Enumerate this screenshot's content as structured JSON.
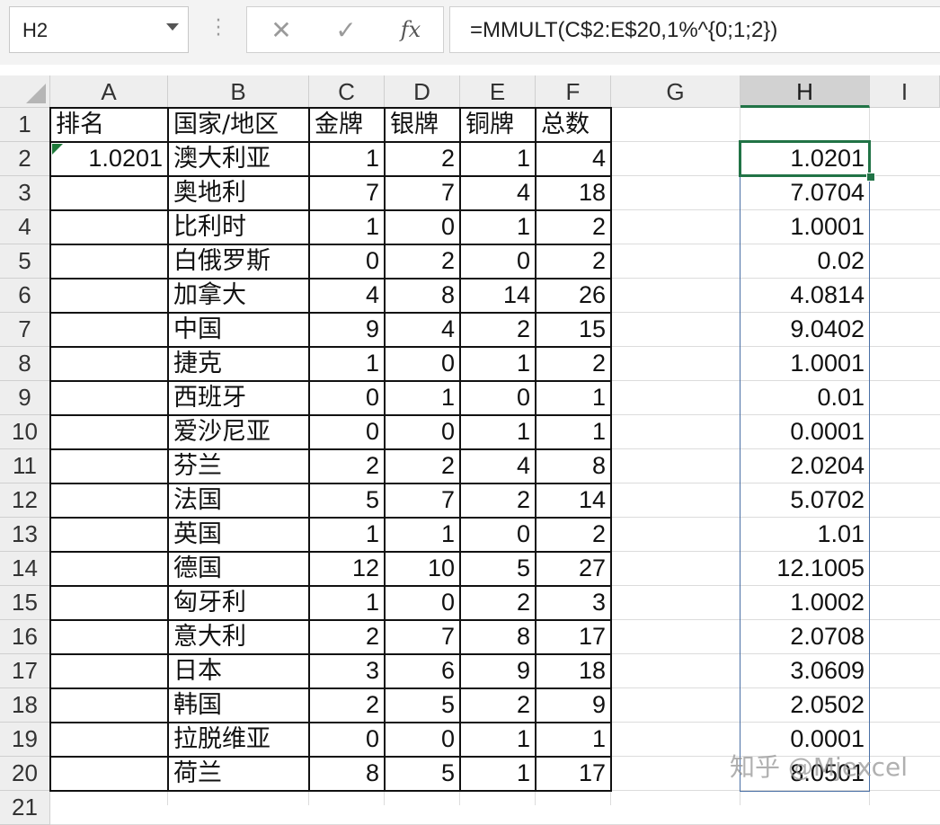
{
  "formula_bar": {
    "name_box": "H2",
    "cancel_icon": "✕",
    "enter_icon": "✓",
    "fx_label": "fx",
    "formula": "=MMULT(C$2:E$20,1%^{0;1;2})"
  },
  "columns": [
    "A",
    "B",
    "C",
    "D",
    "E",
    "F",
    "G",
    "H",
    "I"
  ],
  "selected_column": "H",
  "rows": [
    "1",
    "2",
    "3",
    "4",
    "5",
    "6",
    "7",
    "8",
    "9",
    "10",
    "11",
    "12",
    "13",
    "14",
    "15",
    "16",
    "17",
    "18",
    "19",
    "20",
    "21"
  ],
  "table": {
    "headers": [
      "排名",
      "国家/地区",
      "金牌",
      "银牌",
      "铜牌",
      "总数"
    ],
    "a2_value": "1.0201",
    "records": [
      {
        "country": "澳大利亚",
        "gold": "1",
        "silver": "2",
        "bronze": "1",
        "total": "4",
        "h": "1.0201"
      },
      {
        "country": "奥地利",
        "gold": "7",
        "silver": "7",
        "bronze": "4",
        "total": "18",
        "h": "7.0704"
      },
      {
        "country": "比利时",
        "gold": "1",
        "silver": "0",
        "bronze": "1",
        "total": "2",
        "h": "1.0001"
      },
      {
        "country": "白俄罗斯",
        "gold": "0",
        "silver": "2",
        "bronze": "0",
        "total": "2",
        "h": "0.02"
      },
      {
        "country": "加拿大",
        "gold": "4",
        "silver": "8",
        "bronze": "14",
        "total": "26",
        "h": "4.0814"
      },
      {
        "country": "中国",
        "gold": "9",
        "silver": "4",
        "bronze": "2",
        "total": "15",
        "h": "9.0402"
      },
      {
        "country": "捷克",
        "gold": "1",
        "silver": "0",
        "bronze": "1",
        "total": "2",
        "h": "1.0001"
      },
      {
        "country": "西班牙",
        "gold": "0",
        "silver": "1",
        "bronze": "0",
        "total": "1",
        "h": "0.01"
      },
      {
        "country": "爱沙尼亚",
        "gold": "0",
        "silver": "0",
        "bronze": "1",
        "total": "1",
        "h": "0.0001"
      },
      {
        "country": "芬兰",
        "gold": "2",
        "silver": "2",
        "bronze": "4",
        "total": "8",
        "h": "2.0204"
      },
      {
        "country": "法国",
        "gold": "5",
        "silver": "7",
        "bronze": "2",
        "total": "14",
        "h": "5.0702"
      },
      {
        "country": "英国",
        "gold": "1",
        "silver": "1",
        "bronze": "0",
        "total": "2",
        "h": "1.01"
      },
      {
        "country": "德国",
        "gold": "12",
        "silver": "10",
        "bronze": "5",
        "total": "27",
        "h": "12.1005"
      },
      {
        "country": "匈牙利",
        "gold": "1",
        "silver": "0",
        "bronze": "2",
        "total": "3",
        "h": "1.0002"
      },
      {
        "country": "意大利",
        "gold": "2",
        "silver": "7",
        "bronze": "8",
        "total": "17",
        "h": "2.0708"
      },
      {
        "country": "日本",
        "gold": "3",
        "silver": "6",
        "bronze": "9",
        "total": "18",
        "h": "3.0609"
      },
      {
        "country": "韩国",
        "gold": "2",
        "silver": "5",
        "bronze": "2",
        "total": "9",
        "h": "2.0502"
      },
      {
        "country": "拉脱维亚",
        "gold": "0",
        "silver": "0",
        "bronze": "1",
        "total": "1",
        "h": "0.0001"
      },
      {
        "country": "荷兰",
        "gold": "8",
        "silver": "5",
        "bronze": "1",
        "total": "17",
        "h": "8.0501"
      }
    ]
  },
  "watermark": "知乎 @Mjexcel",
  "colors": {
    "selection": "#217346",
    "range_border": "#4a6fa5",
    "header_bg": "#eeeeee",
    "gridline": "#dcdcdc"
  }
}
